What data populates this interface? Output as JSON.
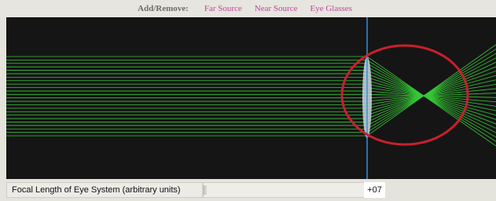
{
  "toolbar": {
    "label": "Add/Remove:",
    "far_source": "Far Source",
    "near_source": "Near Source",
    "eye_glasses": "Eye Glasses"
  },
  "colors": {
    "ray": "#35c935",
    "lens": "#c8d6e0",
    "axis": "#3a8fd6",
    "circle": "#c8202c",
    "background": "#151515",
    "link": "#c0479b"
  },
  "slider": {
    "label": "Focal Length of Eye System (arbitrary units)",
    "value": "+07"
  }
}
